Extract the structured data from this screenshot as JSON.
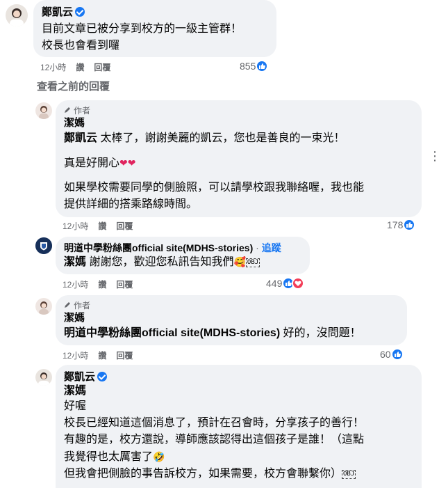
{
  "c1": {
    "name": "鄭凱云",
    "lines": [
      "目前文章已被分享到校方的一級主管群！",
      "校長也會看到囉"
    ],
    "time": "12小時",
    "like": "讚",
    "reply": "回覆",
    "count": "855"
  },
  "view_prev": "查看之前的回覆",
  "c2": {
    "author_tag": "作者",
    "name": "潔媽",
    "mention": "鄭凱云",
    "line1": " 太棒了，謝謝美麗的凱云，您也是善良的一束光！",
    "line2": "真是好開心",
    "line3": "如果學校需要同學的側臉照，可以請學校跟我聯絡喔，我也能",
    "line4": "提供詳細的搭乘路線時間。",
    "time": "12小時",
    "like": "讚",
    "reply": "回覆",
    "count": "178"
  },
  "c3": {
    "name": "明道中學粉絲團official site(MDHS-stories)",
    "follow": "追蹤",
    "mention": "潔媽",
    "text": " 謝謝您，歡迎您私訊告知我們",
    "time": "12小時",
    "like": "讚",
    "reply": "回覆",
    "count": "449"
  },
  "c4": {
    "author_tag": "作者",
    "name": "潔媽",
    "mention": "明道中學粉絲團official site(MDHS-stories)",
    "text": " 好的，沒問題！",
    "time": "12小時",
    "like": "讚",
    "reply": "回覆",
    "count": "60"
  },
  "c5": {
    "name": "鄭凱云",
    "mention": "潔媽",
    "line1": "好喔",
    "line2": "校長已經知道這個消息了，預計在召會時，分享孩子的善行！",
    "line3": "有趣的是，校方還說，導師應該認得出這個孩子是誰！（這點",
    "line4": "我覺得也太厲害了",
    "line5": "但我會把側臉的事告訴校方，如果需要，校方會聯繫你）"
  },
  "icons": {
    "like": "like-icon",
    "heart": "heart-icon",
    "verified": "verified-badge-icon",
    "pencil": "pencil-icon",
    "more": "more-options-icon"
  },
  "colors": {
    "like": "#1877f2",
    "heart": "#f33e58",
    "bubble": "#f0f2f5",
    "secondary": "#65676b"
  }
}
